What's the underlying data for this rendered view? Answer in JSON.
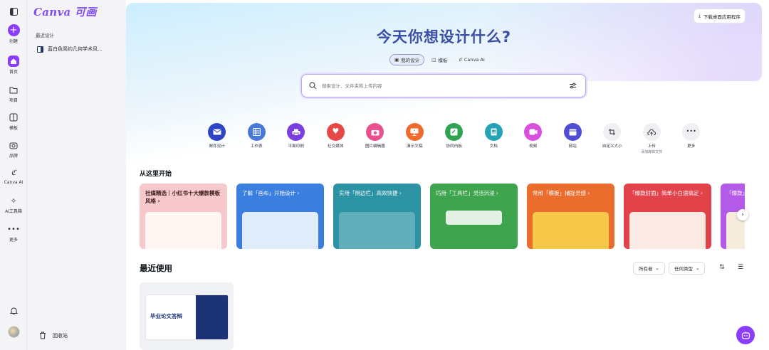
{
  "rail": {
    "items": [
      {
        "label": "创建",
        "icon": "plus-icon"
      },
      {
        "label": "首页",
        "icon": "home-icon"
      },
      {
        "label": "项目",
        "icon": "folder-icon"
      },
      {
        "label": "模板",
        "icon": "template-icon"
      },
      {
        "label": "品牌",
        "icon": "brand-icon"
      },
      {
        "label": "Canva AI",
        "icon": "canva-ai-icon"
      },
      {
        "label": "AI工具箱",
        "icon": "sparkle-icon"
      },
      {
        "label": "更多",
        "icon": "more-icon"
      }
    ],
    "accent": "#8b3dff"
  },
  "panel": {
    "logo": "Canva 可画",
    "recent_heading": "最近设计",
    "recent_items": [
      "蓝白色简约几何学术风..."
    ],
    "trash_label": "回收站"
  },
  "header": {
    "download_label": "下载桌面应用程序",
    "title": "今天你想设计什么?",
    "tabs": [
      {
        "label": "我的设计",
        "icon": "my-designs-icon",
        "active": true
      },
      {
        "label": "模板",
        "icon": "template-icon",
        "active": false
      },
      {
        "label": "Canva AI",
        "icon": "canva-ai-icon",
        "active": false
      }
    ],
    "search_placeholder": "搜索设计、文件夹和上传内容"
  },
  "categories": [
    {
      "label": "邮件设计",
      "color": "#2d45c4",
      "icon": "email-icon"
    },
    {
      "label": "工作表",
      "color": "#4a78d9",
      "icon": "sheet-icon"
    },
    {
      "label": "平面印刷",
      "color": "#7a3fe0",
      "icon": "print-icon"
    },
    {
      "label": "社交媒体",
      "color": "#e64848",
      "icon": "heart-icon"
    },
    {
      "label": "图片编辑器",
      "color": "#e8508e",
      "icon": "camera-icon"
    },
    {
      "label": "演示文稿",
      "color": "#ee6b2b",
      "icon": "presentation-icon"
    },
    {
      "label": "协同白板",
      "color": "#2fa352",
      "icon": "whiteboard-icon"
    },
    {
      "label": "文档",
      "color": "#23a2b8",
      "icon": "document-icon"
    },
    {
      "label": "视频",
      "color": "#d94fe0",
      "icon": "video-icon"
    },
    {
      "label": "网站",
      "color": "#4e4ed4",
      "icon": "website-icon"
    },
    {
      "label": "自定义大小",
      "color": "#eef0f3",
      "icon": "custom-size-icon"
    },
    {
      "label": "上传",
      "sub": "添加媒体文件",
      "color": "#eef0f3",
      "icon": "upload-icon"
    },
    {
      "label": "更多",
      "color": "#eef0f3",
      "icon": "more-icon"
    }
  ],
  "start_section": {
    "heading": "从这里开始",
    "cards": [
      {
        "title": "社媒精选｜小红书十大爆款模板风格 ›",
        "bg": "#f7c8cc",
        "fg": "#3a1a1a"
      },
      {
        "title": "了解「画布」开始设计 ›",
        "bg": "#3a7fe0",
        "fg": "#ffffff"
      },
      {
        "title": "实用「侧边栏」高效快捷 ›",
        "bg": "#2b93a3",
        "fg": "#ffffff"
      },
      {
        "title": "巧用「工具栏」灵活沉浸 ›",
        "bg": "#3fa44e",
        "fg": "#ffffff"
      },
      {
        "title": "常用「模板」捕捉灵感 ›",
        "bg": "#ea6d2d",
        "fg": "#ffffff"
      },
      {
        "title": "「爆款封面」简单小白速搞定 ›",
        "bg": "#e2424a",
        "fg": "#ffffff"
      },
      {
        "title": "「爆款」门 ›",
        "bg": "#b35ae8",
        "fg": "#ffffff"
      }
    ]
  },
  "recent_section": {
    "heading": "最近使用",
    "owner_filter": "所有者",
    "type_filter": "任何类型",
    "thumb_title": "毕业论文答辩"
  }
}
